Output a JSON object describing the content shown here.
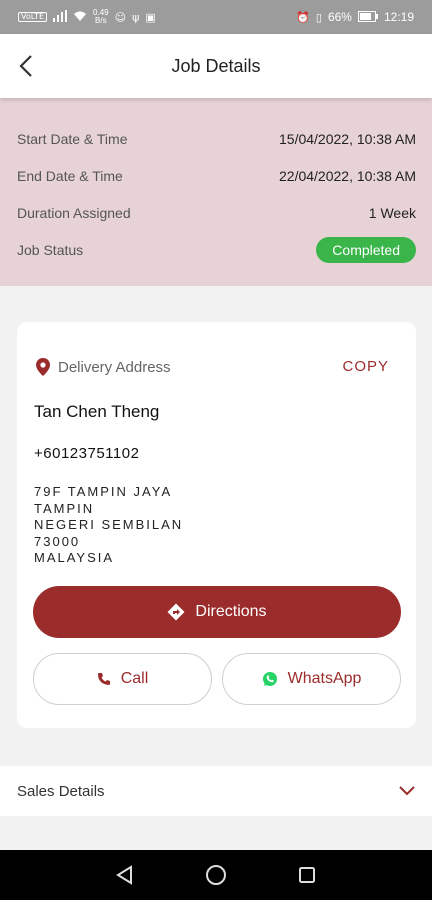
{
  "status_bar": {
    "network_tag": "VoLTE",
    "speed_top": "0.49",
    "speed_bottom": "B/s",
    "battery": "66%",
    "time": "12:19"
  },
  "header": {
    "title": "Job Details",
    "back_icon": "chevron-left-icon"
  },
  "summary": {
    "rows": [
      {
        "label": "Start Date & Time",
        "value": "15/04/2022, 10:38 AM"
      },
      {
        "label": "End Date & Time",
        "value": "22/04/2022, 10:38 AM"
      },
      {
        "label": "Duration Assigned",
        "value": "1 Week"
      }
    ],
    "status_label": "Job Status",
    "status_value": "Completed"
  },
  "delivery": {
    "heading": "Delivery Address",
    "copy_label": "COPY",
    "name": "Tan Chen Theng",
    "phone": "+60123751102",
    "address_lines": [
      "79F TAMPIN JAYA",
      "TAMPIN",
      "NEGERI SEMBILAN",
      "73000",
      "MALAYSIA"
    ],
    "directions_label": "Directions",
    "call_label": "Call",
    "whatsapp_label": "WhatsApp"
  },
  "sales": {
    "label": "Sales Details"
  },
  "colors": {
    "brand": "#9b2c2c",
    "summary_bg": "#e7d3d5",
    "success": "#39b54a",
    "whatsapp": "#25d366"
  }
}
